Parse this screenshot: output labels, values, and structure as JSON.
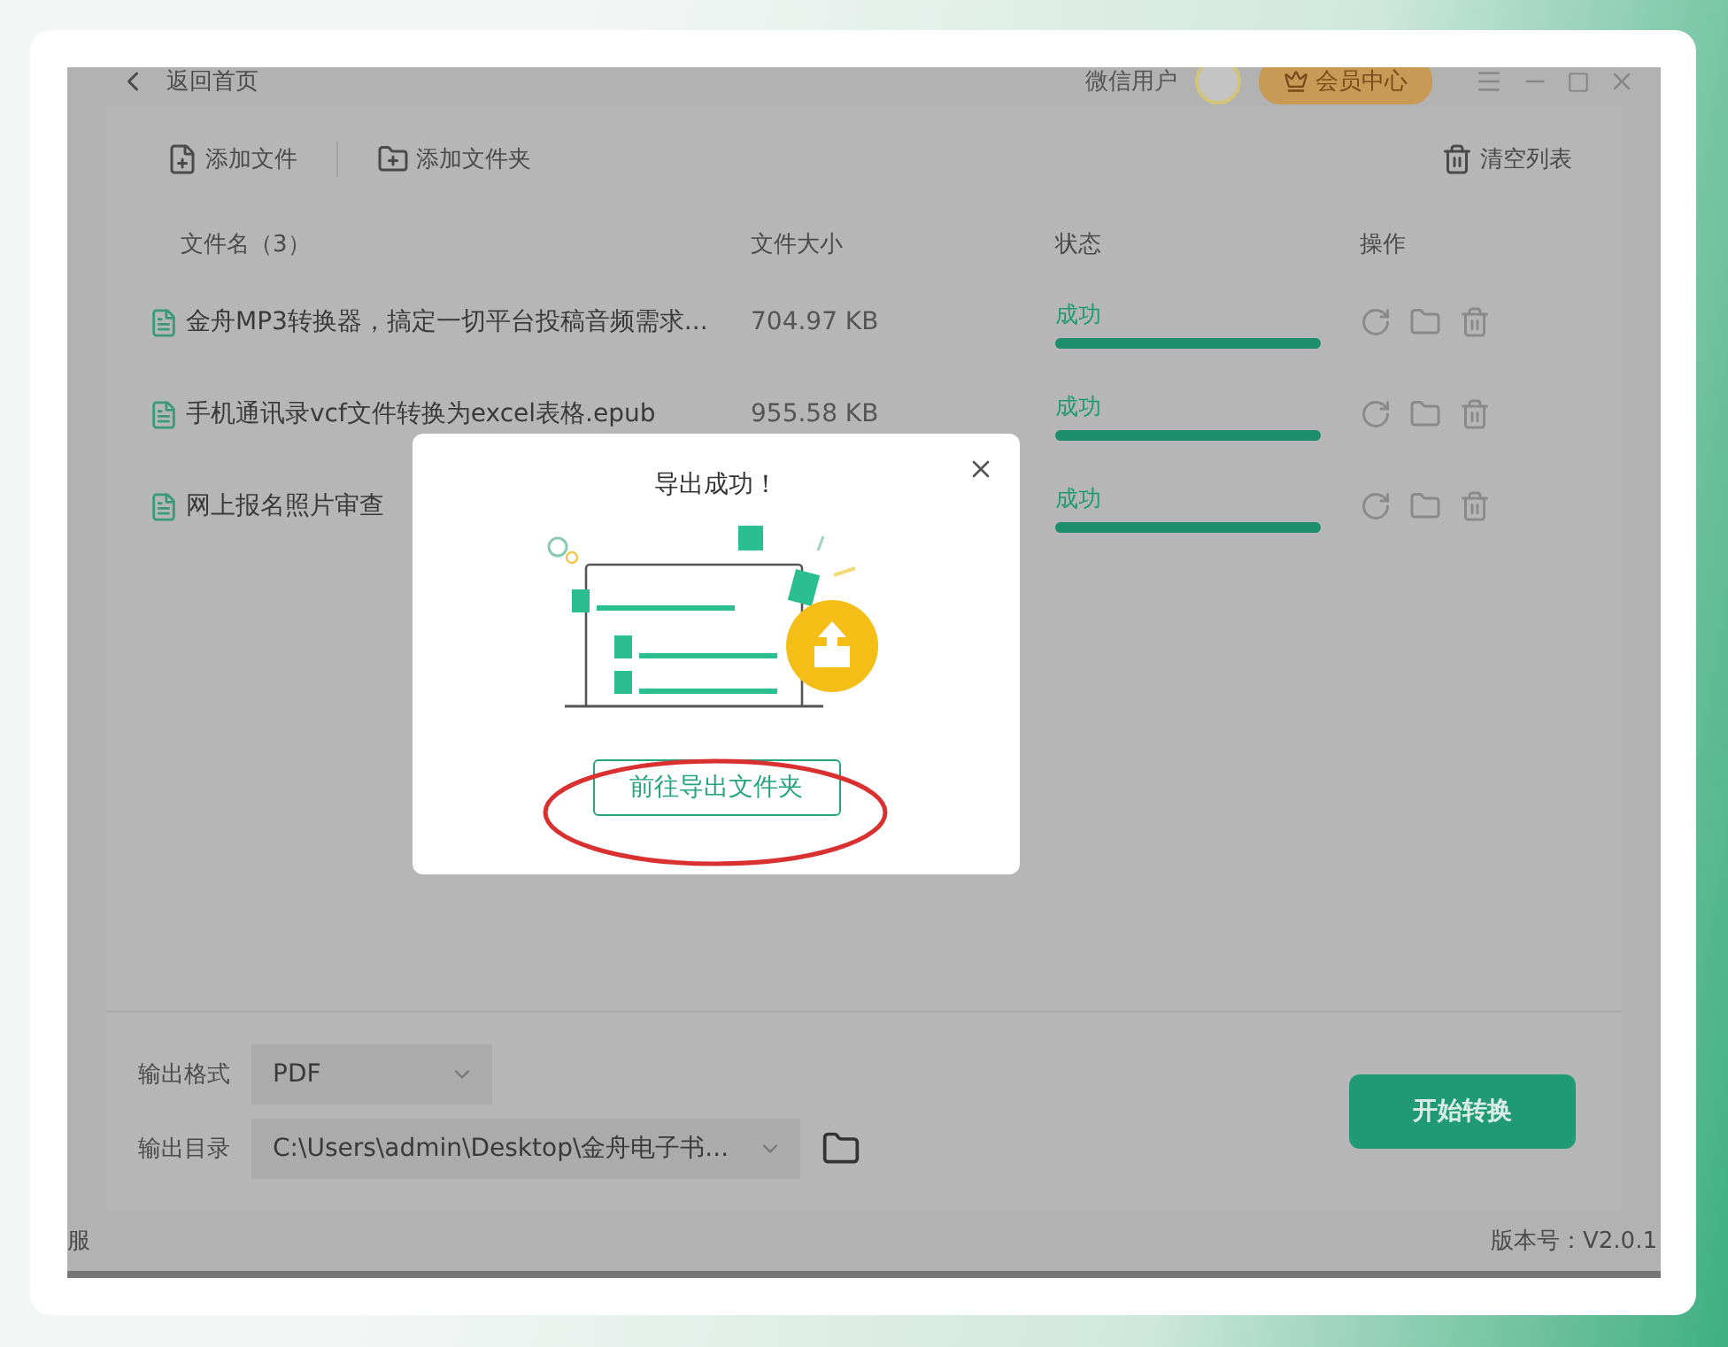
{
  "header": {
    "back_label": "返回首页",
    "user_name": "微信用户",
    "vip_button": "会员中心"
  },
  "toolbar": {
    "add_file": "添加文件",
    "add_folder": "添加文件夹",
    "clear_list": "清空列表"
  },
  "table": {
    "columns": [
      "文件名（3）",
      "文件大小",
      "状态",
      "操作"
    ],
    "rows": [
      {
        "name": "金舟MP3转换器，搞定一切平台投稿音频需求...",
        "size": "704.97 KB",
        "status": "成功",
        "level": 1
      },
      {
        "name": "手机通讯录vcf文件转换为excel表格.epub",
        "size": "955.58 KB",
        "status": "成功",
        "level": 1
      },
      {
        "name": "网上报名照片审查",
        "size": "",
        "status": "成功",
        "level": 1
      }
    ]
  },
  "dialog": {
    "title": "导出成功！",
    "button": "前往导出文件夹"
  },
  "output": {
    "format_label": "输出格式",
    "format_value": "PDF",
    "dir_label": "输出目录",
    "dir_value": "C:\\Users\\admin\\Desktop\\金舟电子书...",
    "start_button": "开始转换"
  },
  "status_bar": {
    "left": "服",
    "version": "版本号：V2.0.1"
  }
}
